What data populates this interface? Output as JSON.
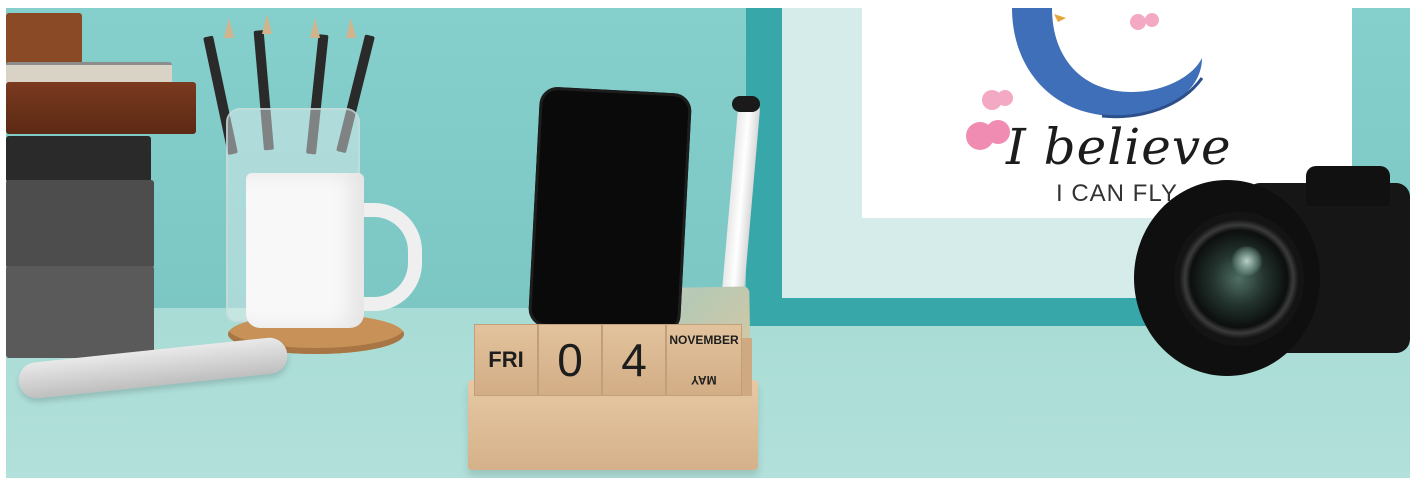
{
  "scene": {
    "poster": {
      "headline": "I believe",
      "subline": "I CAN FLY"
    },
    "calendar": {
      "day": "FRI",
      "digit_1": "0",
      "digit_2": "4",
      "month": "NOVEMBER",
      "month_flipped": "MAY"
    }
  }
}
